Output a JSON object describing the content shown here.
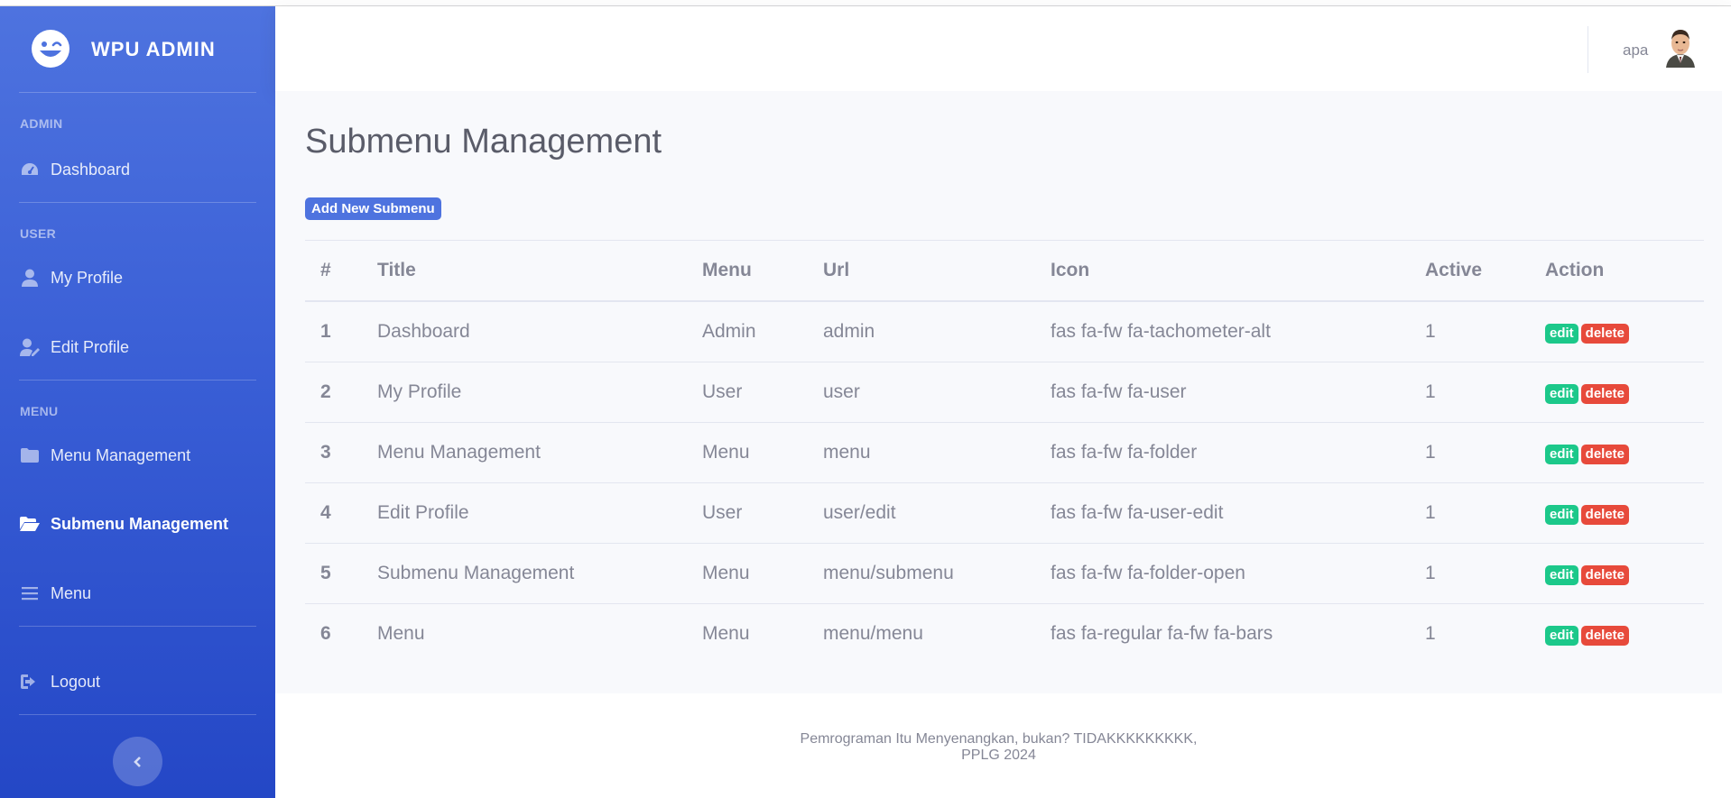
{
  "brand": {
    "title": "WPU ADMIN",
    "icon": "laugh-wink-icon"
  },
  "sidebar": {
    "headings": [
      "ADMIN",
      "USER",
      "MENU"
    ],
    "items": [
      {
        "label": "Dashboard",
        "icon": "tachometer-icon"
      },
      {
        "label": "My Profile",
        "icon": "user-icon"
      },
      {
        "label": "Edit Profile",
        "icon": "user-edit-icon"
      },
      {
        "label": "Menu Management",
        "icon": "folder-icon"
      },
      {
        "label": "Submenu Management",
        "icon": "folder-open-icon",
        "active": true
      },
      {
        "label": "Menu",
        "icon": "bars-icon"
      },
      {
        "label": "Logout",
        "icon": "sign-out-icon"
      }
    ],
    "toggle_icon": "chevron-left-icon"
  },
  "topbar": {
    "username": "apa"
  },
  "main": {
    "title": "Submenu Management",
    "add_button": "Add New Submenu",
    "table": {
      "headers": [
        "#",
        "Title",
        "Menu",
        "Url",
        "Icon",
        "Active",
        "Action"
      ],
      "rows": [
        {
          "num": "1",
          "title": "Dashboard",
          "menu": "Admin",
          "url": "admin",
          "icon": "fas fa-fw fa-tachometer-alt",
          "active": "1"
        },
        {
          "num": "2",
          "title": "My Profile",
          "menu": "User",
          "url": "user",
          "icon": "fas fa-fw fa-user",
          "active": "1"
        },
        {
          "num": "3",
          "title": "Menu Management",
          "menu": "Menu",
          "url": "menu",
          "icon": "fas fa-fw fa-folder",
          "active": "1"
        },
        {
          "num": "4",
          "title": "Edit Profile",
          "menu": "User",
          "url": "user/edit",
          "icon": "fas fa-fw fa-user-edit",
          "active": "1"
        },
        {
          "num": "5",
          "title": "Submenu Management",
          "menu": "Menu",
          "url": "menu/submenu",
          "icon": "fas fa-fw fa-folder-open",
          "active": "1"
        },
        {
          "num": "6",
          "title": "Menu",
          "menu": "Menu",
          "url": "menu/menu",
          "icon": "fas fa-regular fa-fw fa-bars",
          "active": "1"
        }
      ],
      "edit_label": "edit",
      "delete_label": "delete"
    }
  },
  "footer": {
    "line1": "Pemrograman Itu Menyenangkan, bukan? TIDAKKKKKKKKK,",
    "line2": "PPLG 2024"
  },
  "colors": {
    "primary": "#4e73df",
    "success": "#1cc88a",
    "danger": "#e74a3b",
    "text": "#858796"
  }
}
